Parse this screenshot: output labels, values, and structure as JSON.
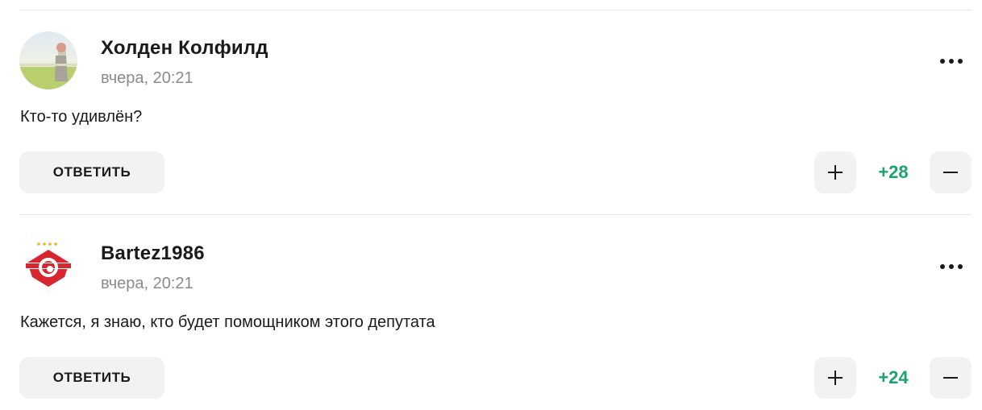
{
  "colors": {
    "score": "#1aa36b",
    "button_bg": "#f2f2f2",
    "meta": "#8a8a8a"
  },
  "comments": [
    {
      "author": "Холден Колфилд",
      "time": "вчера, 20:21",
      "text": "Кто-то удивлён?",
      "reply_label": "ОТВЕТИТЬ",
      "score": "+28",
      "avatar_icon": "user-photo-avatar",
      "more_icon": "more-dots-icon"
    },
    {
      "author": "Bartez1986",
      "time": "вчера, 20:21",
      "text": "Кажется, я знаю, кто будет помощником этого депутата",
      "reply_label": "ОТВЕТИТЬ",
      "score": "+24",
      "avatar_icon": "spartak-logo-avatar",
      "more_icon": "more-dots-icon"
    }
  ]
}
